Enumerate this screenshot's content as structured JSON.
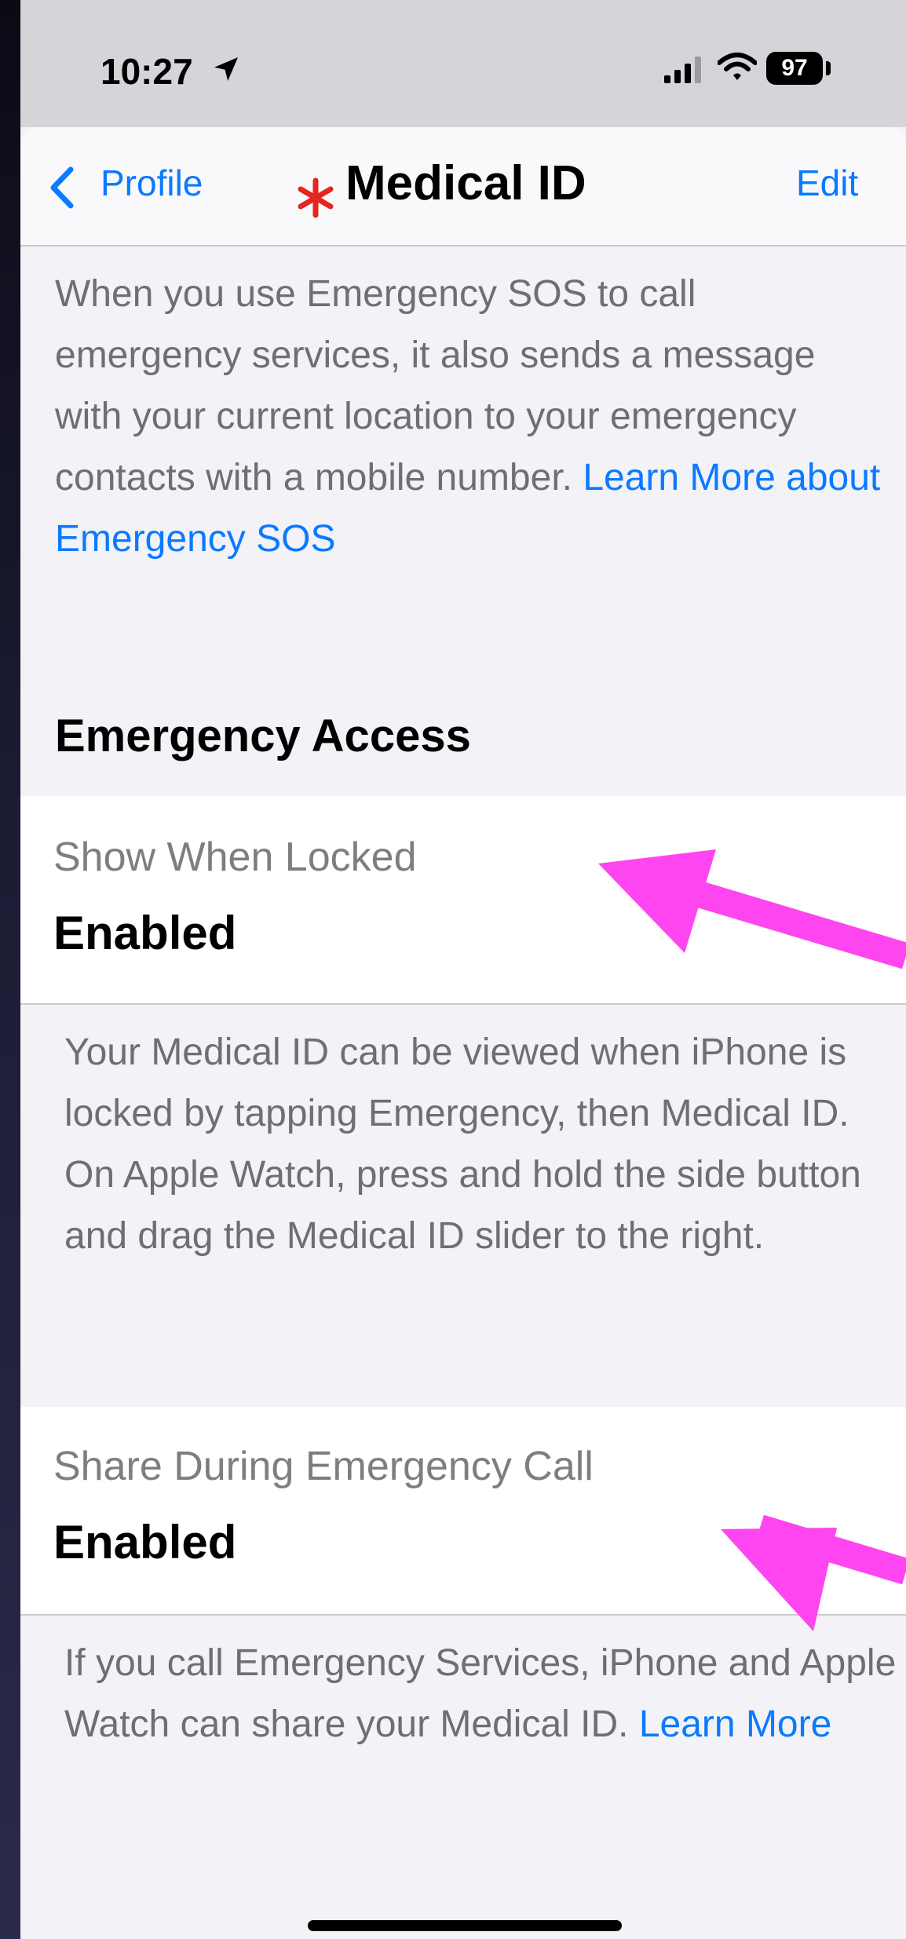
{
  "status_bar": {
    "time": "10:27",
    "battery": "97",
    "icons": [
      "location-arrow-icon",
      "cellular-signal-icon",
      "wifi-icon",
      "battery-icon"
    ]
  },
  "nav": {
    "back_label": "Profile",
    "title": "Medical ID",
    "edit_label": "Edit",
    "title_icon": "medical-asterisk-icon",
    "title_icon_color": "#e5261e"
  },
  "intro": {
    "text": "When you use Emergency SOS to call emergency services, it also sends a message with your current location to your emergency contacts with a mobile number. ",
    "link": "Learn More about Emergency SOS"
  },
  "emergency_access": {
    "header": "Emergency Access",
    "show_when_locked": {
      "label": "Show When Locked",
      "value": "Enabled",
      "footnote": "Your Medical ID can be viewed when iPhone is locked by tapping Emergency, then Medical ID. On Apple Watch, press and hold the side button and drag the Medical ID slider to the right."
    },
    "share_during_call": {
      "label": "Share During Emergency Call",
      "value": "Enabled",
      "footnote": "If you call Emergency Services, iPhone and Apple Watch can share your Medical ID. ",
      "link": "Learn More"
    }
  },
  "colors": {
    "accent": "#0a7aff",
    "annotation_arrow": "#ff45f0"
  }
}
